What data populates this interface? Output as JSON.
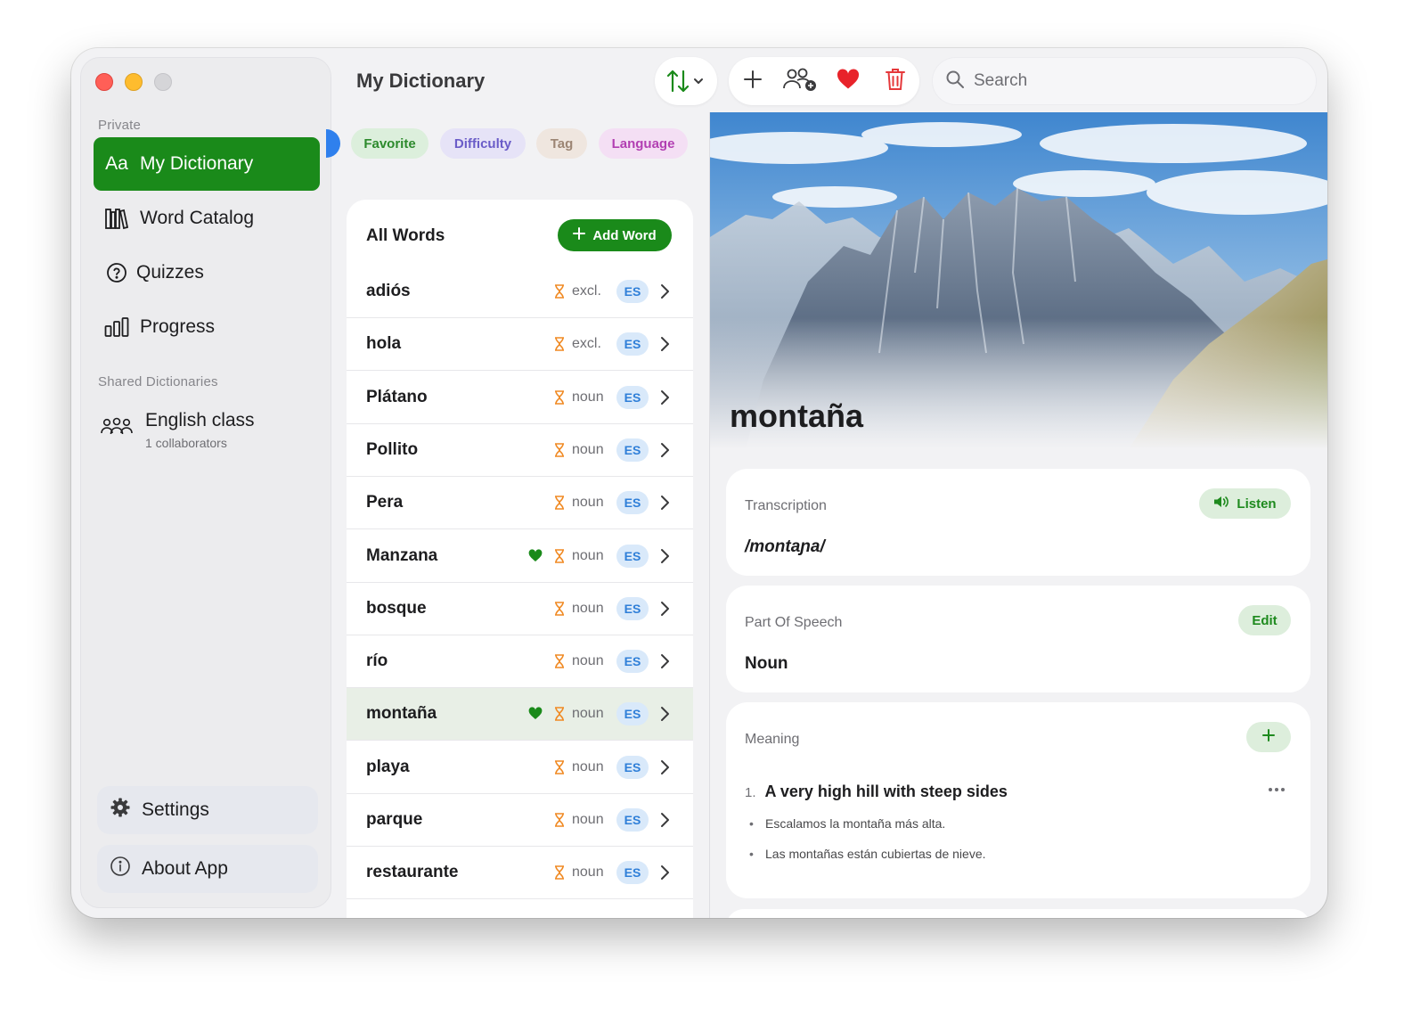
{
  "colors": {
    "accent_green": "#1a8a1a",
    "favorite_heart": "#e8232a",
    "trash_red": "#e5383b",
    "lang_badge_bg": "#d9e9fa",
    "lang_badge_fg": "#2f7fd8",
    "hourglass": "#f08a24"
  },
  "window": {
    "title": "My Dictionary"
  },
  "sidebar": {
    "private_label": "Private",
    "items": [
      {
        "label": "My Dictionary",
        "icon": "aa-icon",
        "active": true
      },
      {
        "label": "Word Catalog",
        "icon": "books-icon"
      },
      {
        "label": "Quizzes",
        "icon": "question-circle-icon"
      },
      {
        "label": "Progress",
        "icon": "bar-chart-icon"
      }
    ],
    "shared_label": "Shared Dictionaries",
    "shared": {
      "title": "English class",
      "subtitle": "1 collaborators",
      "icon": "group-icon"
    },
    "settings_label": "Settings",
    "about_label": "About App"
  },
  "toolbar": {
    "sort_icon": "sort-arrows-icon",
    "add_icon": "plus-icon",
    "share_icon": "add-user-icon",
    "favorite_icon": "heart-icon",
    "delete_icon": "trash-icon",
    "search_placeholder": "Search"
  },
  "filters": [
    {
      "label": "Favorite",
      "bg": "#dcefdc",
      "fg": "#2d8a2d"
    },
    {
      "label": "Difficulty",
      "bg": "#e6e3f7",
      "fg": "#6a5cc8"
    },
    {
      "label": "Tag",
      "bg": "#efe6df",
      "fg": "#9c8574"
    },
    {
      "label": "Language",
      "bg": "#f4dff4",
      "fg": "#b23fb2"
    }
  ],
  "word_list": {
    "header": "All Words",
    "add_label": "Add Word",
    "rows": [
      {
        "word": "adiós",
        "pos": "excl.",
        "lang": "ES",
        "favorite": false
      },
      {
        "word": "hola",
        "pos": "excl.",
        "lang": "ES",
        "favorite": false
      },
      {
        "word": "Plátano",
        "pos": "noun",
        "lang": "ES",
        "favorite": false
      },
      {
        "word": "Pollito",
        "pos": "noun",
        "lang": "ES",
        "favorite": false
      },
      {
        "word": "Pera",
        "pos": "noun",
        "lang": "ES",
        "favorite": false
      },
      {
        "word": "Manzana",
        "pos": "noun",
        "lang": "ES",
        "favorite": true
      },
      {
        "word": "bosque",
        "pos": "noun",
        "lang": "ES",
        "favorite": false
      },
      {
        "word": "río",
        "pos": "noun",
        "lang": "ES",
        "favorite": false
      },
      {
        "word": "montaña",
        "pos": "noun",
        "lang": "ES",
        "favorite": true,
        "selected": true
      },
      {
        "word": "playa",
        "pos": "noun",
        "lang": "ES",
        "favorite": false
      },
      {
        "word": "parque",
        "pos": "noun",
        "lang": "ES",
        "favorite": false
      },
      {
        "word": "restaurante",
        "pos": "noun",
        "lang": "ES",
        "favorite": false
      }
    ]
  },
  "detail": {
    "word": "montaña",
    "transcription_label": "Transcription",
    "transcription": "/montaɲa/",
    "listen_label": "Listen",
    "pos_label": "Part Of Speech",
    "pos_value": "Noun",
    "edit_label": "Edit",
    "meaning_label": "Meaning",
    "meanings": [
      {
        "number": "1.",
        "text": "A very high hill with steep sides",
        "examples": [
          "Escalamos la montaña más alta.",
          "Las montañas están cubiertas de nieve."
        ]
      }
    ]
  }
}
